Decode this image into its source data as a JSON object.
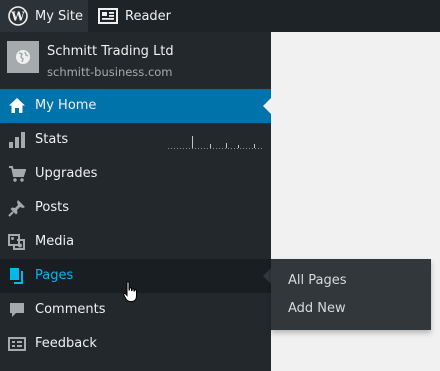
{
  "admin_bar": {
    "my_site_label": "My Site",
    "reader_label": "Reader",
    "my_site_icon": "wordpress-icon",
    "reader_icon": "reader-icon"
  },
  "site": {
    "name": "Schmitt Trading Ltd",
    "domain": "schmitt-business.com",
    "icon": "globe-icon"
  },
  "menu": {
    "items": [
      {
        "label": "My Home",
        "icon": "home-icon",
        "state": "current"
      },
      {
        "label": "Stats",
        "icon": "bar-chart-icon"
      },
      {
        "label": "Upgrades",
        "icon": "cart-icon"
      },
      {
        "label": "Posts",
        "icon": "pin-icon"
      },
      {
        "label": "Media",
        "icon": "media-icon"
      },
      {
        "label": "Pages",
        "icon": "pages-icon",
        "state": "hover"
      },
      {
        "label": "Comments",
        "icon": "comment-icon"
      },
      {
        "label": "Feedback",
        "icon": "feedback-icon"
      }
    ]
  },
  "flyout": {
    "items": [
      {
        "label": "All Pages"
      },
      {
        "label": "Add New"
      }
    ]
  },
  "colors": {
    "admin_bar_bg": "#1d2327",
    "sidebar_bg": "#23282d",
    "accent": "#0073aa",
    "hover_text": "#00b9eb"
  }
}
